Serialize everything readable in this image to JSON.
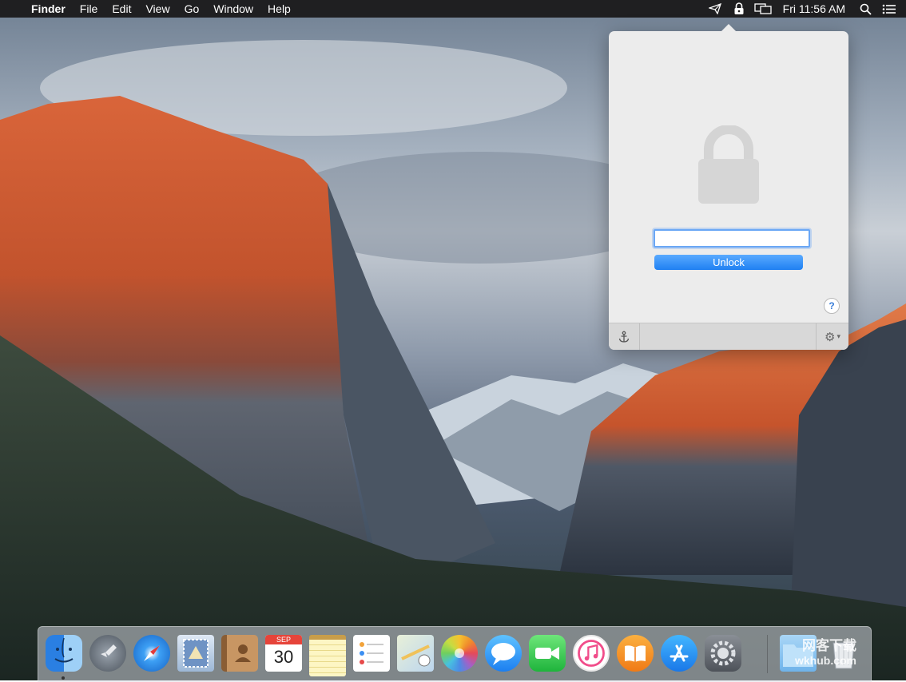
{
  "menubar": {
    "apple": "",
    "app": "Finder",
    "menus": [
      "File",
      "Edit",
      "View",
      "Go",
      "Window",
      "Help"
    ],
    "clock": "Fri 11:56 AM",
    "status_icons": [
      "paper-plane-icon",
      "lock-icon",
      "display-mirror-icon",
      "search-icon",
      "list-icon"
    ]
  },
  "popover": {
    "unlock_label": "Unlock",
    "help_label": "?",
    "password_value": ""
  },
  "dock": {
    "apps": [
      "Finder",
      "Launchpad",
      "Safari",
      "Mail",
      "Contacts",
      "Calendar",
      "Notes",
      "Reminders",
      "Maps",
      "Photos",
      "Messages",
      "FaceTime",
      "iTunes",
      "iBooks",
      "App Store",
      "System Preferences"
    ],
    "calendar_month": "SEP",
    "calendar_day": "30"
  },
  "watermark": {
    "line1": "网客下载",
    "line2": "wkhub.com"
  },
  "colors": {
    "accent": "#1f80f2",
    "menubar": "#1f1f21"
  }
}
